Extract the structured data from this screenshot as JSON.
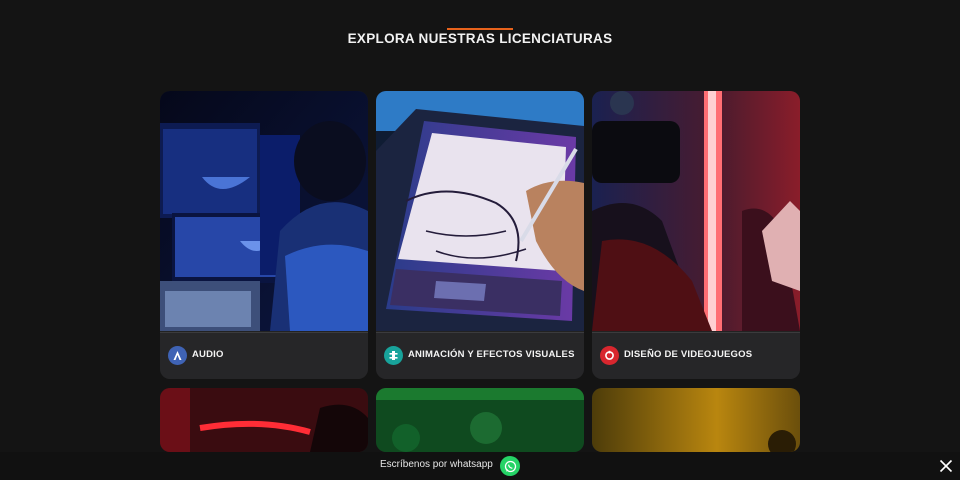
{
  "section": {
    "title": "EXPLORA NUESTRAS LICENCIATURAS",
    "accent_color": "#e8631c"
  },
  "cards": [
    {
      "label": "AUDIO",
      "icon": "audio-badge-icon",
      "badge_color": "#3f63b5"
    },
    {
      "label": "ANIMACIÓN Y EFECTOS VISUALES",
      "icon": "animation-badge-icon",
      "badge_color": "#18a39b"
    },
    {
      "label": "DISEÑO DE VIDEOJUEGOS",
      "icon": "videogame-badge-icon",
      "badge_color": "#d8262e"
    }
  ],
  "whatsapp": {
    "text": "Escríbenos por whatsapp",
    "icon": "whatsapp-icon",
    "color": "#25d366"
  },
  "close": {
    "icon": "close-icon"
  }
}
